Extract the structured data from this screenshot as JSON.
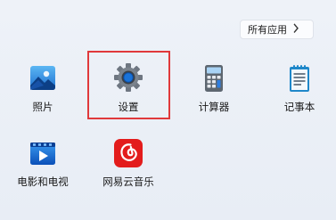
{
  "all_apps_button": {
    "label": "所有应用",
    "chevron": "chevron-right-icon"
  },
  "apps": [
    {
      "name": "photos",
      "label": "照片",
      "icon": "photos-icon"
    },
    {
      "name": "settings",
      "label": "设置",
      "icon": "gear-icon"
    },
    {
      "name": "calculator",
      "label": "计算器",
      "icon": "calculator-icon"
    },
    {
      "name": "notepad",
      "label": "记事本",
      "icon": "notepad-icon"
    },
    {
      "name": "movies-tv",
      "label": "电影和电视",
      "icon": "movies-tv-icon"
    },
    {
      "name": "netease-music",
      "label": "网易云音乐",
      "icon": "netease-music-icon"
    }
  ],
  "colors": {
    "highlight_border": "#e0393b",
    "netease_red": "#e31c1c",
    "photos_blue": "#2d7bd8",
    "movies_blue": "#1566d6"
  }
}
